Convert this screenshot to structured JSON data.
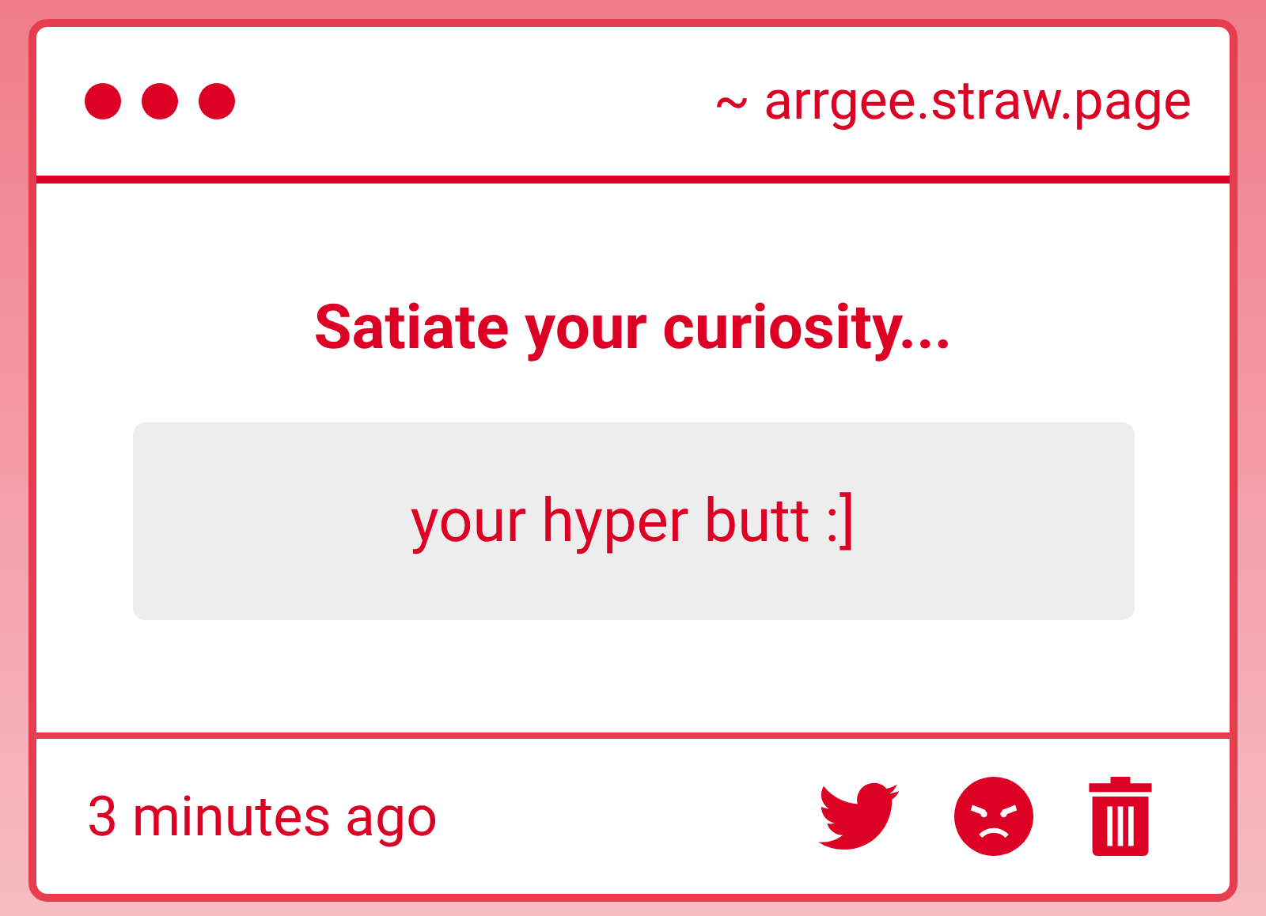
{
  "header": {
    "address": "~ arrgee.straw.page"
  },
  "question": {
    "title": "Satiate your curiosity...",
    "answer": "your hyper butt :]"
  },
  "footer": {
    "time": "3 minutes ago"
  }
}
